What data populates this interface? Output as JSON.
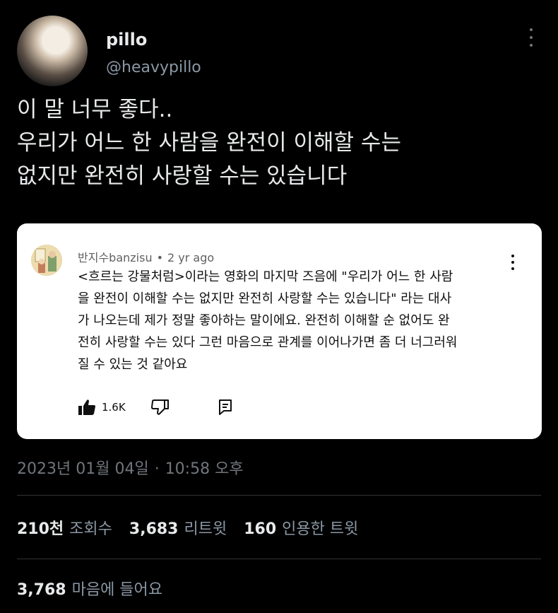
{
  "tweet": {
    "display_name": "pillo",
    "handle": "@heavypillo",
    "text_lines": [
      "이 말 너무 좋다..",
      "우리가 어느 한 사람을 완전이 이해할 수는",
      "없지만 완전히 사랑할 수는 있습니다"
    ],
    "timestamp_date": "2023년 01월 04일",
    "timestamp_sep": "·",
    "timestamp_time": "10:58 오후"
  },
  "embedded_comment": {
    "author": "반지수banzisu",
    "sep": "•",
    "age": "2 yr ago",
    "text_lines": [
      "<흐르는 강물처럼>이라는 영화의 마지막 즈음에 \"우리가 어느 한 사람",
      "을 완전이 이해할 수는 없지만 완전히 사랑할 수는 있습니다\" 라는 대사",
      "가 나오는데 제가 정말 좋아하는 말이에요. 완전히 이해할 순 없어도 완",
      "전히 사랑할 수는 있다 그런 마음으로 관계를 이어나가면 좀 더 너그러워",
      "질 수 있는 것 같아요"
    ],
    "like_count": "1.6K",
    "icons": {
      "like": "thumbs-up-icon",
      "dislike": "thumbs-down-icon",
      "reply": "reply-icon",
      "more": "more-vertical-icon"
    }
  },
  "stats": {
    "views_count": "210천",
    "views_label": "조회수",
    "retweets_count": "3,683",
    "retweets_label": "리트윗",
    "quotes_count": "160",
    "quotes_label": "인용한 트윗",
    "likes_count": "3,768",
    "likes_label": "마음에 들어요"
  },
  "colors": {
    "background": "#000000",
    "text_primary": "#e7e9ea",
    "text_secondary": "#71767b",
    "card_background": "#ffffff"
  }
}
